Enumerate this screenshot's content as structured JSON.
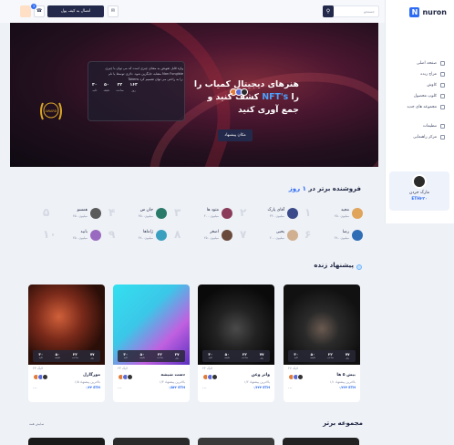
{
  "app": {
    "logo_text": "nuron",
    "logo_letter": "N"
  },
  "topbar": {
    "search_placeholder": "جستجو",
    "wallet_button": "اتصال به کیف پول",
    "badge_count": "3"
  },
  "sidebar": {
    "items": [
      {
        "label": "صفحه اصلی",
        "icon": "home-icon"
      },
      {
        "label": "مراج زنده",
        "icon": "live-icon"
      },
      {
        "label": "کاوش",
        "icon": "explore-icon"
      },
      {
        "label": "کلوپ محصول",
        "icon": "product-icon"
      },
      {
        "label": "مجموعه های جدید",
        "icon": "collection-icon"
      },
      {
        "label": "تنظیمات",
        "icon": "settings-icon"
      },
      {
        "label": "مرکز راهنمایی",
        "icon": "help-icon"
      }
    ],
    "user": {
      "name": "مارک جردن",
      "balance": "ETH۲۳۰"
    }
  },
  "hero": {
    "title_line1": "هنرهای دیجیتال کمیاب را",
    "title_line2_pre": "کشف کنید و ",
    "title_line2_accent": "NFT's",
    "title_line2_post": " را",
    "title_line3": "جمع آوری کنید",
    "bid_button": "مکان پیشنهاد",
    "auction_desc": "واژه قابل تعویض به معنای چیزی است که می توان با چیزی مشابه جایگزین شود. دلاری توسط یا نام Non Fungible Tokens را به راحتی می توان تقسیم کرد.",
    "timer": [
      {
        "value": "۱۶۳",
        "label": "روز"
      },
      {
        "value": "۲۲",
        "label": "ساعت"
      },
      {
        "value": "۵۰",
        "label": "دقیقه"
      },
      {
        "value": "۳۰",
        "label": "ثانیه"
      }
    ],
    "award_label": "AWARD"
  },
  "top_sellers": {
    "title_pre": "فروشنده برتر در ",
    "title_accent": "۱ روز",
    "sellers": [
      {
        "rank": "۱",
        "name": "مجید",
        "price": "۲۵۰ میلیون"
      },
      {
        "rank": "۲",
        "name": "آقای پارک",
        "price": "۳۴۰ میلیون"
      },
      {
        "rank": "۳",
        "name": "متود ها",
        "price": "۴۰۰ میلیون"
      },
      {
        "rank": "۴",
        "name": "جان س",
        "price": "۳۵۰ میلیون"
      },
      {
        "rank": "۵",
        "name": "همسو",
        "price": "۲۵۰ میلیون"
      },
      {
        "rank": "۶",
        "name": "رضا",
        "price": "۴۸۰ میلیون"
      },
      {
        "rank": "۷",
        "name": "یحیی",
        "price": "۲۰۰ میلیون"
      },
      {
        "rank": "۸",
        "name": "اصغر",
        "price": "۲۵۰ میلیون"
      },
      {
        "rank": "۹",
        "name": "ژاماها",
        "price": "۴۸۰ میلیون"
      },
      {
        "rank": "۱۰",
        "name": "بابید",
        "price": "۲۵۰ میلیون"
      }
    ]
  },
  "live_bids": {
    "title": "پیشنهاد زنده",
    "cards": [
      {
        "title": "بیش ۵ ها",
        "likes": "۲۷ لایک",
        "bid": "بالاترین پیشنهاد ۱/۱",
        "price": "۰/۲۲۴ ETH",
        "countdown": [
          "۷۷",
          "۲۲",
          "۵۰",
          "۳۰"
        ]
      },
      {
        "title": "واتر وعن",
        "likes": "۲۴ لایک",
        "bid": "بالاترین پیشنهاد ۱/۲",
        "price": "۰/۳۲۴ ETH",
        "countdown": [
          "۷۷",
          "۲۲",
          "۵۰",
          "۳۰"
        ]
      },
      {
        "title": "دست شیشه",
        "likes": "۲۳ لایک",
        "bid": "بالاترین پیشنهاد ۱/۳",
        "price": "۰/۵۳۲ ETH",
        "countdown": [
          "۲۷",
          "۲۲",
          "۵۰",
          "۳۰"
        ]
      },
      {
        "title": "مورگارل",
        "likes": "۲۳ لایک",
        "bid": "بالاترین پیشنهاد ۱/۵",
        "price": "۰/۲۴ ETH",
        "countdown": [
          "۷۷",
          "۲۲",
          "۵۰",
          "۳۰"
        ]
      }
    ],
    "countdown_labels": [
      "روز",
      "ساعت",
      "دقیقه",
      "ثانیه"
    ]
  },
  "top_collection": {
    "title": "مجموعه برتر",
    "show_all": "نمایش همه"
  }
}
